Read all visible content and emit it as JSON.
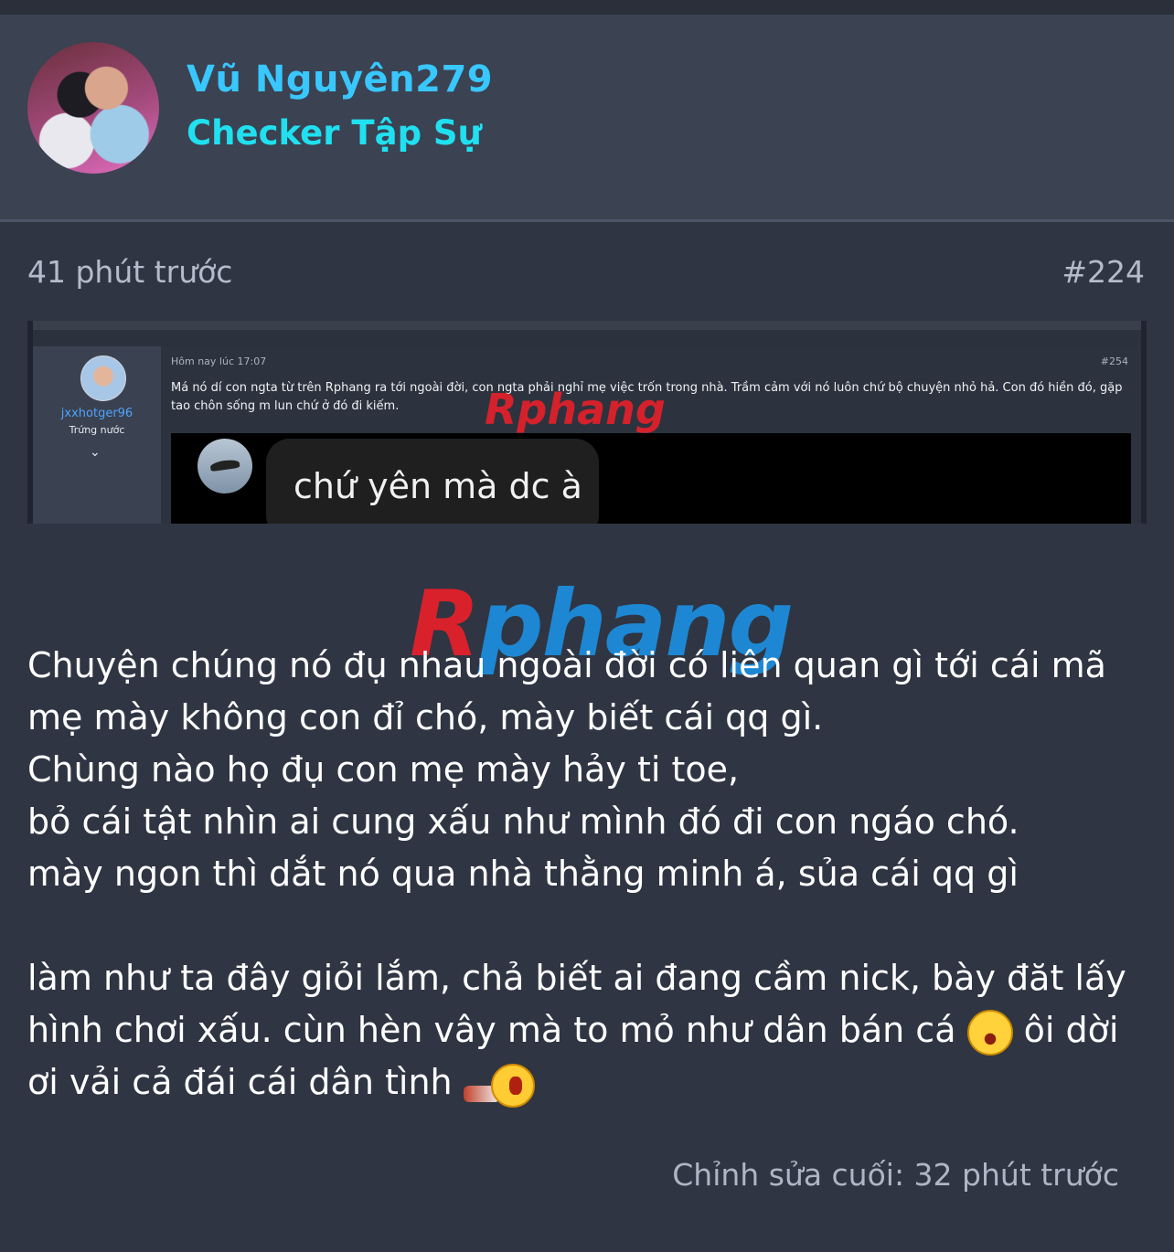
{
  "header": {
    "username": "Vũ Nguyên279",
    "user_title": "Checker Tập Sự"
  },
  "post_meta": {
    "time": "41 phút trước",
    "post_number": "#224"
  },
  "embedded_screenshot": {
    "username": "jxxhotger96",
    "user_title": "Trứng nước",
    "time": "Hôm nay lúc 17:07",
    "post_number": "#254",
    "text": "Má nó dí con ngta từ trên Rphang ra tới ngoài đời, con ngta phải nghỉ mẹ việc trốn trong nhà. Trầm cảm với nó luôn chứ bộ chuyện nhỏ hả. Con đó hiền đó, gặp tao chôn sống m lun chứ ở đó đi kiếm.",
    "chat_bubble": "chứ yên mà dc à",
    "watermark": "Rphang"
  },
  "watermark": {
    "r": "R",
    "rest": "phang"
  },
  "post_body": {
    "line1": "Chuyện chúng nó đụ nhau ngoài đời có liên quan gì tới cái mã mẹ mày không con đỉ chó, mày biết cái qq gì.",
    "line2": "Chùng nào họ đụ con mẹ mày hảy ti toe,",
    "line3": "bỏ cái tật nhìn ai cung xấu như mình đó đi con ngáo chó.",
    "line4": "mày ngon thì dắt nó qua nhà thằng minh á, sủa cái qq gì",
    "line5a": "làm như ta đây giỏi lắm, chả biết ai đang cầm nick, bày đăt lấy hình chơi xấu. cùn hèn vây mà to mỏ như dân bán cá ",
    "line5b": " ôi dời ơi vải cả đái cái dân tình "
  },
  "icons": [
    "laughing-emoji-icon",
    "shouting-emoji-icon"
  ],
  "footer": {
    "edited": "Chỉnh sửa cuối: 32 phút trước"
  },
  "colors": {
    "background": "#2f3542",
    "header_bg": "#3b4252",
    "username": "#38c7ff",
    "user_title": "#20e0f0",
    "meta_text": "#b4bccb"
  }
}
